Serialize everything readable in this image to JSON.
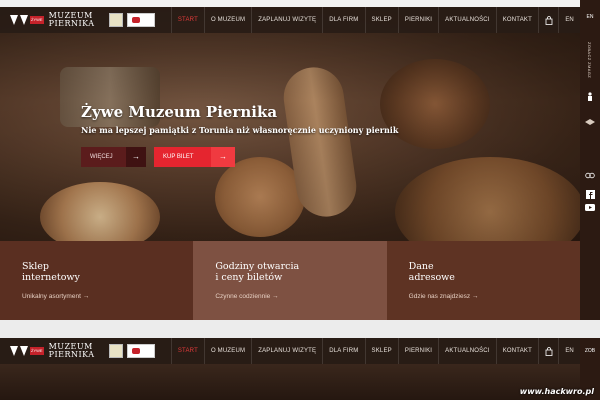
{
  "header": {
    "logo_small": "ŻYWE",
    "logo_line1": "MUZEUM",
    "logo_line2": "PIERNIKA",
    "nav": [
      {
        "label": "START",
        "active": true
      },
      {
        "label": "O MUZEUM",
        "active": false
      },
      {
        "label": "ZAPLANUJ WIZYTĘ",
        "active": false
      },
      {
        "label": "DLA FIRM",
        "active": false
      },
      {
        "label": "SKLEP",
        "active": false
      },
      {
        "label": "PIERNIKI",
        "active": false
      },
      {
        "label": "AKTUALNOŚCI",
        "active": false
      },
      {
        "label": "KONTAKT",
        "active": false
      }
    ],
    "cart_icon": "shopping-bag-icon",
    "language": "EN"
  },
  "hero": {
    "title": "Żywe Muzeum Piernika",
    "subtitle": "Nie ma lepszej pamiątki z Torunia niż własnoręcznie uczyniony piernik",
    "more_label": "WIĘCEJ",
    "ticket_label": "KUP BILET",
    "arrow": "→"
  },
  "rail": {
    "language": "EN",
    "vertical_text": "ZOBACZ ZMAGZ",
    "icons": [
      "person-icon",
      "bird-icon",
      "tripadvisor-icon",
      "facebook-icon",
      "youtube-icon"
    ]
  },
  "panels": [
    {
      "title_line1": "Sklep",
      "title_line2": "internetowy",
      "link": "Unikalny asortyment →"
    },
    {
      "title_line1": "Godziny otwarcia",
      "title_line2": "i ceny biletów",
      "link": "Czynne codziennie →"
    },
    {
      "title_line1": "Dane",
      "title_line2": "adresowe",
      "link": "Gdzie nas znajdziesz →"
    }
  ],
  "bottom_rail": "ZOB",
  "watermark": "www.hackwro.pl",
  "colors": {
    "accent_red": "#e5252f",
    "dark_brown": "#2c1a12",
    "panel_1": "#5a2f21",
    "panel_2": "#7e5142",
    "panel_3": "#5e3323"
  }
}
